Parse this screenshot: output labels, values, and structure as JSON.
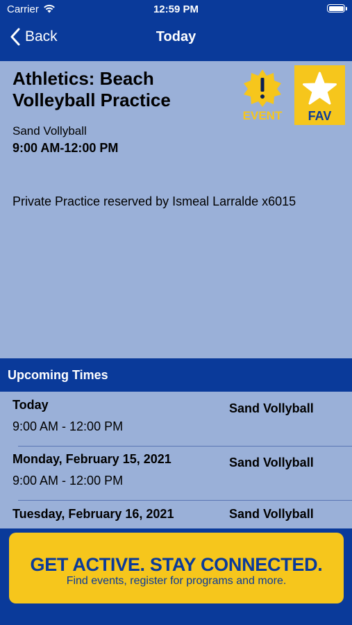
{
  "status_bar": {
    "carrier": "Carrier",
    "time": "12:59 PM"
  },
  "nav": {
    "back_label": "Back",
    "title": "Today"
  },
  "event": {
    "title": "Athletics: Beach Volleyball Practice",
    "event_badge_label": "EVENT",
    "fav_label": "FAV",
    "location": "Sand Vollyball",
    "hours": "9:00 AM-12:00 PM",
    "description": "Private Practice reserved by Ismeal Larralde x6015"
  },
  "upcoming": {
    "header": "Upcoming Times",
    "rows": [
      {
        "date": "Today",
        "time": "9:00 AM - 12:00 PM",
        "location": "Sand Vollyball"
      },
      {
        "date": "Monday, February 15, 2021",
        "time": "9:00 AM - 12:00 PM",
        "location": "Sand Vollyball"
      },
      {
        "date": "Tuesday, February 16, 2021",
        "time": "",
        "location": "Sand Vollyball"
      }
    ]
  },
  "banner": {
    "headline": "GET ACTIVE.  STAY CONNECTED.",
    "subline": "Find events, register for programs and more."
  },
  "colors": {
    "navy": "#0a3a9a",
    "light_blue": "#9ab0d8",
    "yellow": "#f6c61c"
  },
  "icons": [
    "wifi-icon",
    "battery-icon",
    "back-chevron-icon",
    "event-alert-icon",
    "star-icon"
  ]
}
